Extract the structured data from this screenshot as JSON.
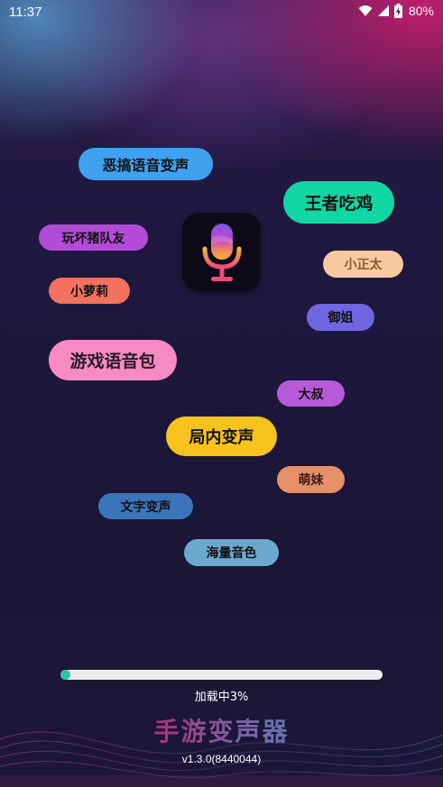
{
  "status_bar": {
    "time": "11:37",
    "battery": "80%",
    "icons": [
      "wifi-icon",
      "signal-icon",
      "battery-charging-icon"
    ]
  },
  "tags": [
    {
      "id": "prank",
      "label": "恶搞语音变声",
      "bg": "#3ea2f1",
      "color": "#111111"
    },
    {
      "id": "chicken",
      "label": "王者吃鸡",
      "bg": "#10d7a3",
      "color": "#111111"
    },
    {
      "id": "friend",
      "label": "玩坏猪队友",
      "bg": "#b44bd8",
      "color": "#111111"
    },
    {
      "id": "zhengtai",
      "label": "小正太",
      "bg": "#f9c9a0",
      "color": "#8a5a3a"
    },
    {
      "id": "loli",
      "label": "小萝莉",
      "bg": "#f2725f",
      "color": "#111111"
    },
    {
      "id": "yujie",
      "label": "御姐",
      "bg": "#7266e0",
      "color": "#111111"
    },
    {
      "id": "gamepack",
      "label": "游戏语音包",
      "bg": "#f78ac2",
      "color": "#2a1a2a"
    },
    {
      "id": "dashu",
      "label": "大叔",
      "bg": "#b65ad8",
      "color": "#111111"
    },
    {
      "id": "ingame",
      "label": "局内变声",
      "bg": "#f7c21c",
      "color": "#111111"
    },
    {
      "id": "mengmei",
      "label": "萌妹",
      "bg": "#e6906a",
      "color": "#3a1a10"
    },
    {
      "id": "text",
      "label": "文字变声",
      "bg": "#3b75b9",
      "color": "#111111"
    },
    {
      "id": "massive",
      "label": "海量音色",
      "bg": "#6ba9d1",
      "color": "#111111"
    }
  ],
  "app_icon": "microphone-icon",
  "loading": {
    "text": "加载中3%",
    "progress": 0.03
  },
  "app_name": "手游变声器",
  "version": "v1.3.0(8440044)",
  "colors": {
    "accent": "#27c8a0",
    "background": "#1d1638"
  }
}
